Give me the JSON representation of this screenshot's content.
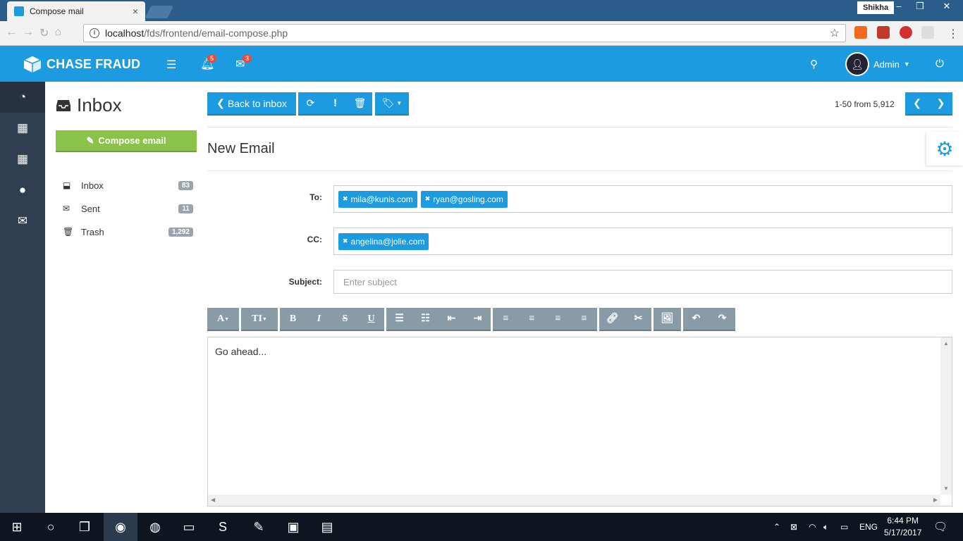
{
  "browser": {
    "tab_title": "Compose mail",
    "tab_close": "×",
    "user": "Shikha",
    "url_host": "localhost",
    "url_path": "/fds/frontend/email-compose.php",
    "window_controls": [
      "–",
      "❐",
      "✕"
    ]
  },
  "header": {
    "brand": "CHASE FRAUD",
    "notifications_count": "5",
    "messages_count": "3",
    "admin_label": "Admin"
  },
  "sidebar": {
    "icons": [
      "dashboard-icon",
      "table-icon",
      "grid-icon",
      "user-icon",
      "envelope-icon"
    ]
  },
  "mailbox": {
    "title": "Inbox",
    "compose_label": "Compose email",
    "folders": [
      {
        "label": "Inbox",
        "count": "83"
      },
      {
        "label": "Sent",
        "count": "11"
      },
      {
        "label": "Trash",
        "count": "1,292"
      }
    ]
  },
  "toolbar": {
    "back_label": "Back to inbox",
    "pagination_text": "1-50 from 5,912"
  },
  "compose": {
    "heading": "New Email",
    "to_label": "To:",
    "to_recipients": [
      "mila@kunis.com",
      "ryan@gosling.com"
    ],
    "cc_label": "CC:",
    "cc_recipients": [
      "angelina@jolie.com"
    ],
    "subject_label": "Subject:",
    "subject_placeholder": "Enter subject",
    "subject_value": "",
    "body_text": "Go ahead..."
  },
  "editor_toolbar": {
    "font_label": "A",
    "size_label": "TI",
    "bold": "B",
    "italic": "I",
    "strike": "S",
    "underline": "U"
  },
  "taskbar": {
    "language": "ENG",
    "time": "6:44 PM",
    "date": "5/17/2017"
  },
  "colors": {
    "brand": "#1d9be0",
    "sidebar": "#2f3e50",
    "compose_green": "#8bc34a",
    "editor_button": "#8a9ba8"
  }
}
